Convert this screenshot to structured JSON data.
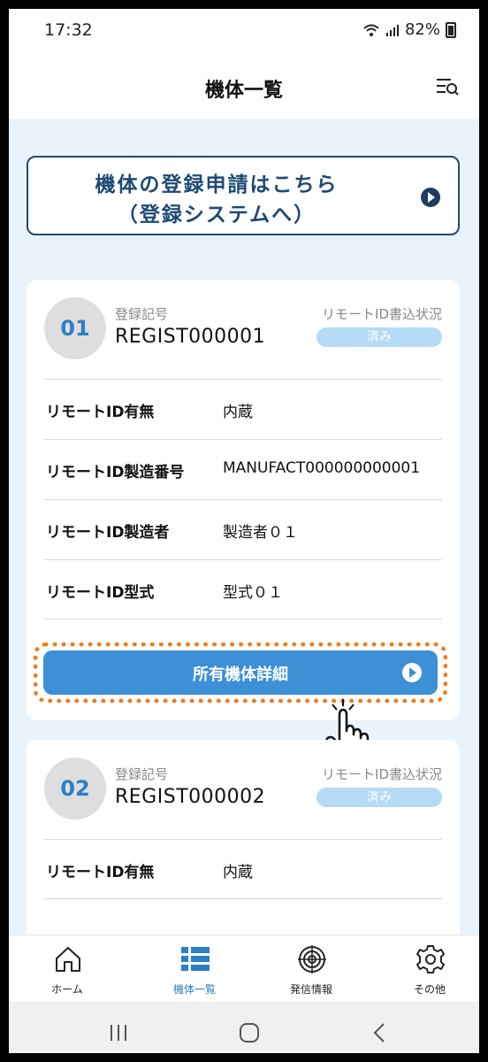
{
  "status_bar": {
    "time": "17:32",
    "battery": "82%"
  },
  "header": {
    "title": "機体一覧"
  },
  "register_banner": {
    "line1": "機体の登録申請はこちら",
    "line2": "（登録システムへ）"
  },
  "cards": [
    {
      "number": "01",
      "reg_label": "登録記号",
      "reg_number": "REGIST000001",
      "rid_status_label": "リモートID書込状況",
      "rid_status": "済み",
      "rows": [
        {
          "label": "リモートID有無",
          "value": "内蔵"
        },
        {
          "label": "リモートID製造番号",
          "value": "MANUFACT000000000001"
        },
        {
          "label": "リモートID製造者",
          "value": "製造者０１"
        },
        {
          "label": "リモートID型式",
          "value": "型式０１"
        }
      ],
      "detail_button": "所有機体詳細"
    },
    {
      "number": "02",
      "reg_label": "登録記号",
      "reg_number": "REGIST000002",
      "rid_status_label": "リモートID書込状況",
      "rid_status": "済み",
      "rows": [
        {
          "label": "リモートID有無",
          "value": "内蔵"
        }
      ]
    }
  ],
  "bottom_nav": [
    {
      "label": "ホーム",
      "icon": "home-icon"
    },
    {
      "label": "機体一覧",
      "icon": "list-icon",
      "active": true
    },
    {
      "label": "発信情報",
      "icon": "target-icon"
    },
    {
      "label": "その他",
      "icon": "gear-icon"
    }
  ],
  "colors": {
    "accent": "#2c7fc6",
    "button": "#3d8fd6",
    "banner_border": "#1e4a73",
    "highlight": "#f07c1b",
    "background": "#e9f3fb"
  }
}
